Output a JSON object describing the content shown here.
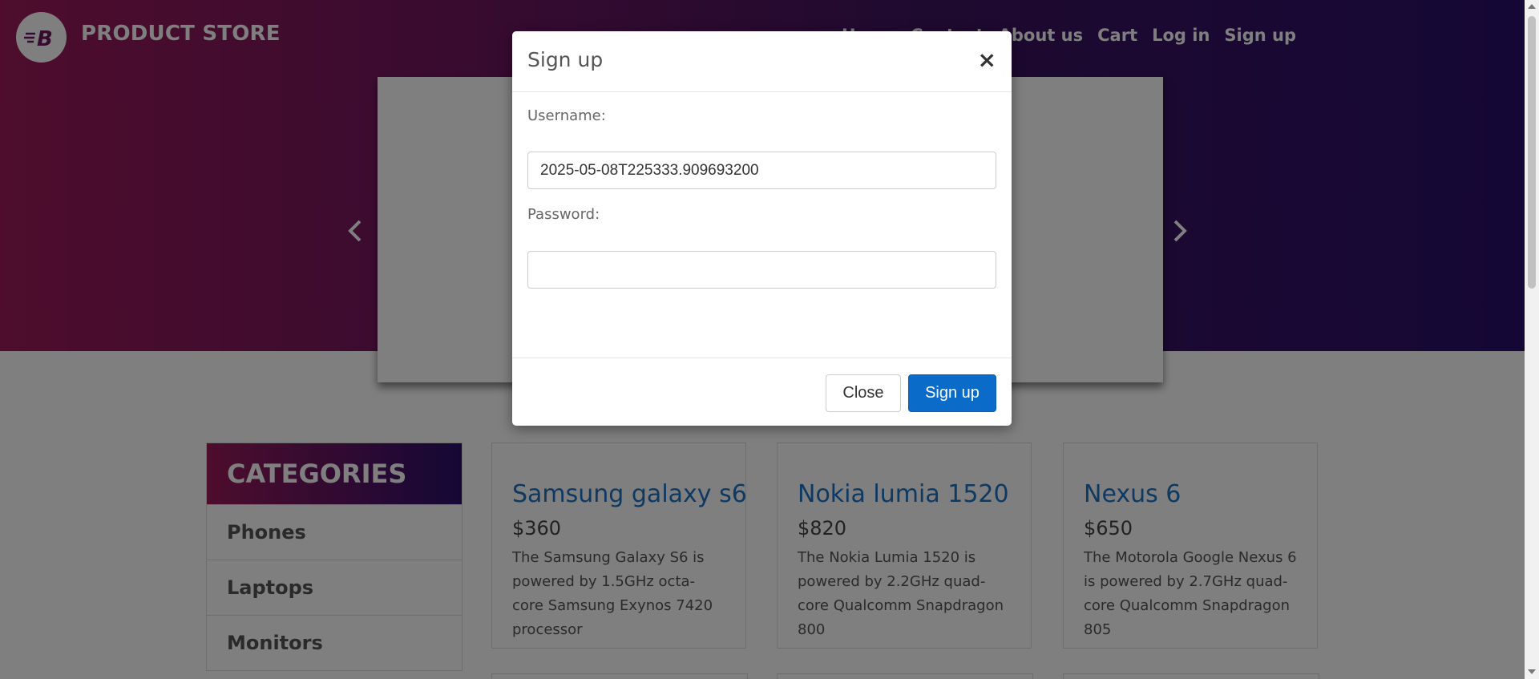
{
  "header": {
    "brand": "PRODUCT STORE",
    "nav": [
      {
        "label": "Home"
      },
      {
        "label": "Contact"
      },
      {
        "label": "About us"
      },
      {
        "label": "Cart"
      },
      {
        "label": "Log in"
      },
      {
        "label": "Sign up"
      }
    ]
  },
  "categories": {
    "title": "CATEGORIES",
    "items": [
      {
        "label": "Phones"
      },
      {
        "label": "Laptops"
      },
      {
        "label": "Monitors"
      }
    ]
  },
  "products": [
    {
      "name": "Samsung galaxy s6",
      "price": "$360",
      "description": "The Samsung Galaxy S6 is powered by 1.5GHz octa-core Samsung Exynos 7420 processor"
    },
    {
      "name": "Nokia lumia 1520",
      "price": "$820",
      "description": "The Nokia Lumia 1520 is powered by 2.2GHz quad-core Qualcomm Snapdragon 800"
    },
    {
      "name": "Nexus 6",
      "price": "$650",
      "description": "The Motorola Google Nexus 6 is powered by 2.7GHz quad-core Qualcomm Snapdragon 805"
    }
  ],
  "modal": {
    "title": "Sign up",
    "close_symbol": "×",
    "username_label": "Username:",
    "username_value": "2025-05-08T225333.909693200",
    "password_label": "Password:",
    "password_value": "",
    "close_button": "Close",
    "submit_button": "Sign up"
  },
  "colors": {
    "header_gradient_start": "#9c1a5a",
    "header_gradient_end": "#2a0f6b",
    "primary_button": "#0b6bc8",
    "product_link": "#1a73c7"
  }
}
